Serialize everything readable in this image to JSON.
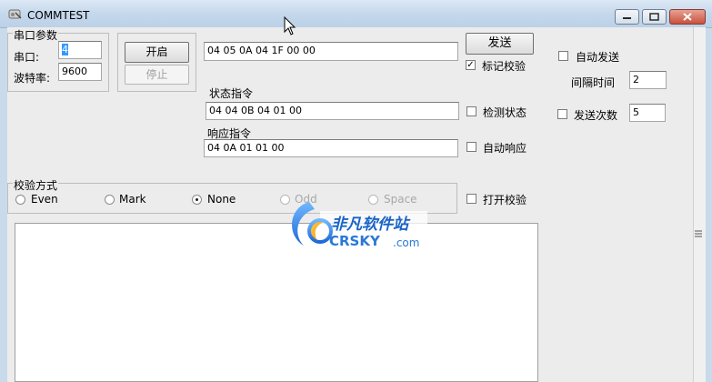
{
  "window": {
    "title": "COMMTEST"
  },
  "serial_group": {
    "title": "串口参数",
    "port_label": "串口:",
    "port_value": "4",
    "baud_label": "波特率:",
    "baud_value": "9600",
    "open_button": "开启",
    "stop_button": "停止"
  },
  "send": {
    "command_value": "04 05 0A 04 1F 00 00",
    "send_button": "发送",
    "mark_check_label": "标记校验",
    "mark_check_checked": true
  },
  "status": {
    "label": "状态指令",
    "value": "04 04 0B 04 01 00",
    "detect_label": "检测状态"
  },
  "response": {
    "label": "响应指令",
    "value": "04 0A 01 01 00",
    "auto_label": "自动响应"
  },
  "auto": {
    "auto_send_label": "自动发送",
    "interval_label": "间隔时间",
    "interval_value": "2",
    "count_label": "发送次数",
    "count_value": "5"
  },
  "parity": {
    "title": "校验方式",
    "options": [
      "Even",
      "Mark",
      "None",
      "Odd",
      "Space"
    ],
    "selected": "None",
    "open_parity_label": "打开校验"
  },
  "watermark": {
    "cn": "非凡软件站",
    "en": "CRSKY",
    "suffix": ".com"
  },
  "colors": {
    "title_gradient": "#c5d8ec",
    "client_bg": "#ececec",
    "accent_blue": "#1a64c8",
    "selection": "#3399ff"
  }
}
